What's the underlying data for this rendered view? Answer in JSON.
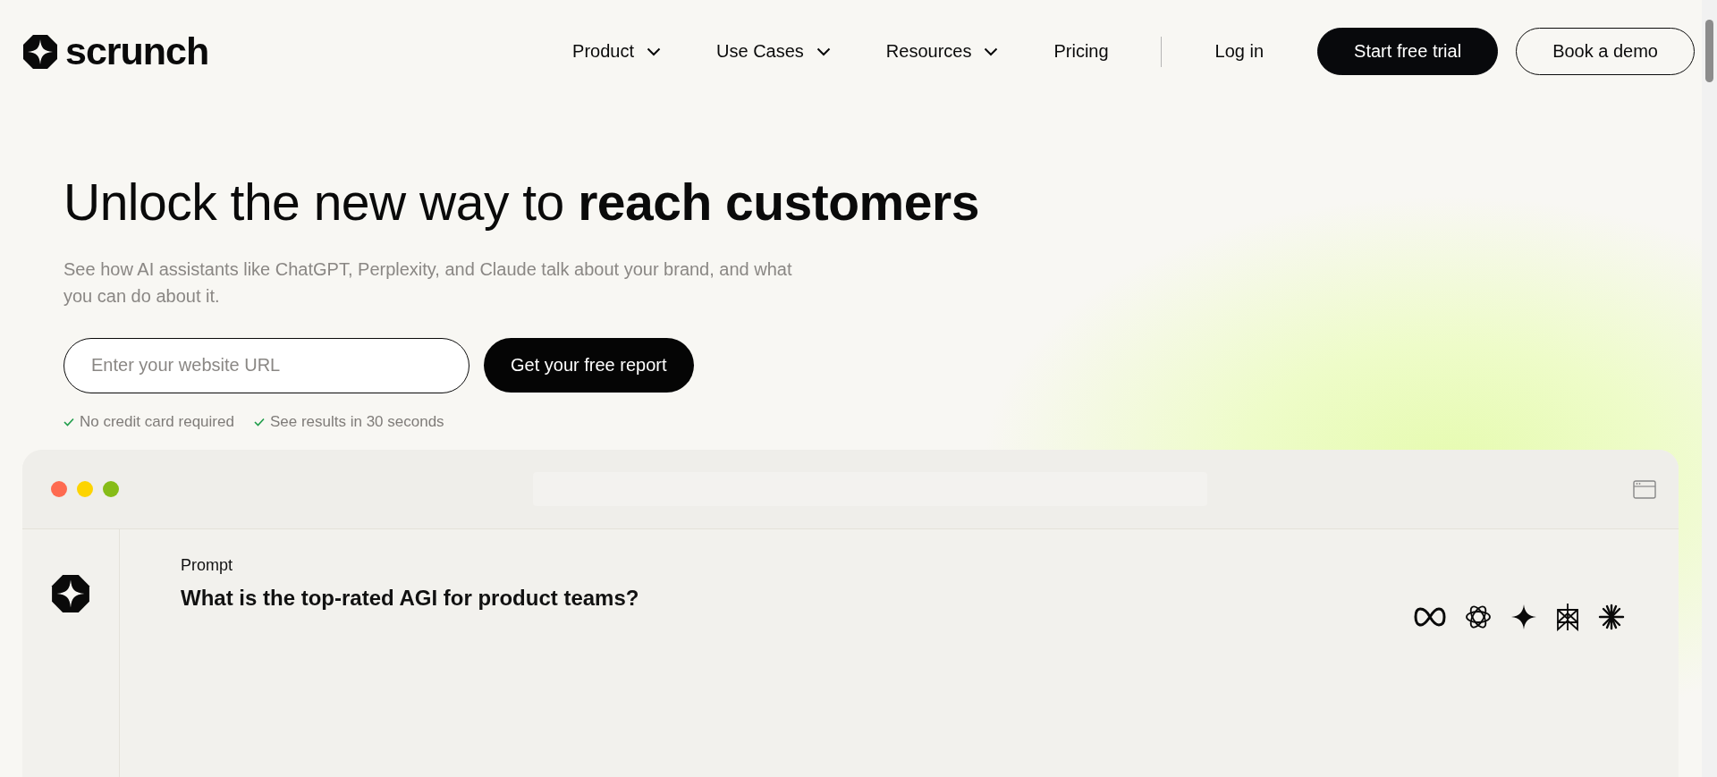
{
  "brand": {
    "name": "scrunch"
  },
  "nav": {
    "items": [
      {
        "label": "Product",
        "kind": "dropdown"
      },
      {
        "label": "Use Cases",
        "kind": "dropdown"
      },
      {
        "label": "Resources",
        "kind": "dropdown"
      },
      {
        "label": "Pricing",
        "kind": "link"
      }
    ],
    "login": "Log in",
    "buttons": [
      {
        "label": "Start free trial",
        "kind": "primary"
      },
      {
        "label": "Book a demo",
        "kind": "outline"
      }
    ]
  },
  "hero": {
    "headline": "Unlock the new way to **reach customers**",
    "subtitle": "See how AI assistants like ChatGPT, Perplexity, and Claude talk about your brand, and what you can do about it.",
    "url_field": {
      "placeholder": "Enter your website URL"
    },
    "cta": "Get your free report",
    "checks": [
      "No credit card required",
      "See results in 30 seconds"
    ]
  },
  "mockup": {
    "prompt_label": "Prompt",
    "prompt": "What is the top-rated AGI for product teams?"
  }
}
